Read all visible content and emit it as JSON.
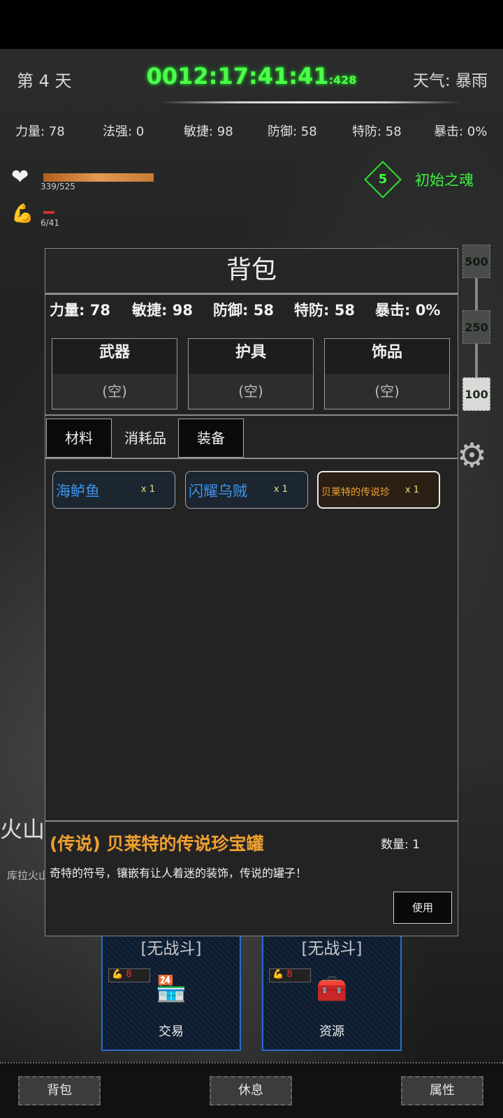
{
  "header": {
    "day": "第 4 天",
    "clock_main": "0012:17:41:41",
    "clock_ms": ":428",
    "weather": "天气: 暴雨"
  },
  "stats": {
    "strength": "力量: 78",
    "magic": "法强: 0",
    "agility": "敏捷: 98",
    "defense": "防御: 58",
    "special_defense": "特防: 58",
    "crit": "暴击: 0%"
  },
  "hp": {
    "text": "339/525",
    "fraction": 0.646
  },
  "stamina": {
    "text": "6/41",
    "fraction": 0.146
  },
  "soul": {
    "level": "5",
    "label": "初始之魂"
  },
  "side_scale": {
    "items": [
      "500",
      "250",
      "100"
    ],
    "active": "100"
  },
  "area": {
    "name": "火山",
    "subtitle": "库拉火山"
  },
  "cards": [
    {
      "title": "[无战斗]",
      "cost": "8",
      "icon": "shop-icon",
      "label": "交易"
    },
    {
      "title": "[无战斗]",
      "cost": "8",
      "icon": "chest-icon",
      "label": "资源"
    }
  ],
  "bottom_nav": [
    "背包",
    "休息",
    "属性"
  ],
  "modal": {
    "title": "背包",
    "stats": [
      "力量: 78",
      "敏捷: 98",
      "防御: 58",
      "特防: 58",
      "暴击: 0%"
    ],
    "slots": [
      {
        "name": "武器",
        "value": "(空)"
      },
      {
        "name": "护具",
        "value": "(空)"
      },
      {
        "name": "饰品",
        "value": "(空)"
      }
    ],
    "tabs": [
      "材料",
      "消耗品",
      "装备"
    ],
    "items": [
      {
        "name": "海鲈鱼",
        "qty": "x 1"
      },
      {
        "name": "闪耀乌贼",
        "qty": "x 1"
      },
      {
        "name": "贝莱特的传说珍",
        "qty": "x 1"
      }
    ],
    "detail": {
      "title": "(传说) 贝莱特的传说珍宝罐",
      "qty": "数量: 1",
      "text": "奇特的符号，镶嵌有让人着迷的装饰，传说的罐子！",
      "use": "使用"
    }
  },
  "colors": {
    "accent_green": "#4cff4c",
    "legend_gold": "#f0a030",
    "item_blue": "#3f93e8",
    "card_border": "#2c6bcc"
  }
}
